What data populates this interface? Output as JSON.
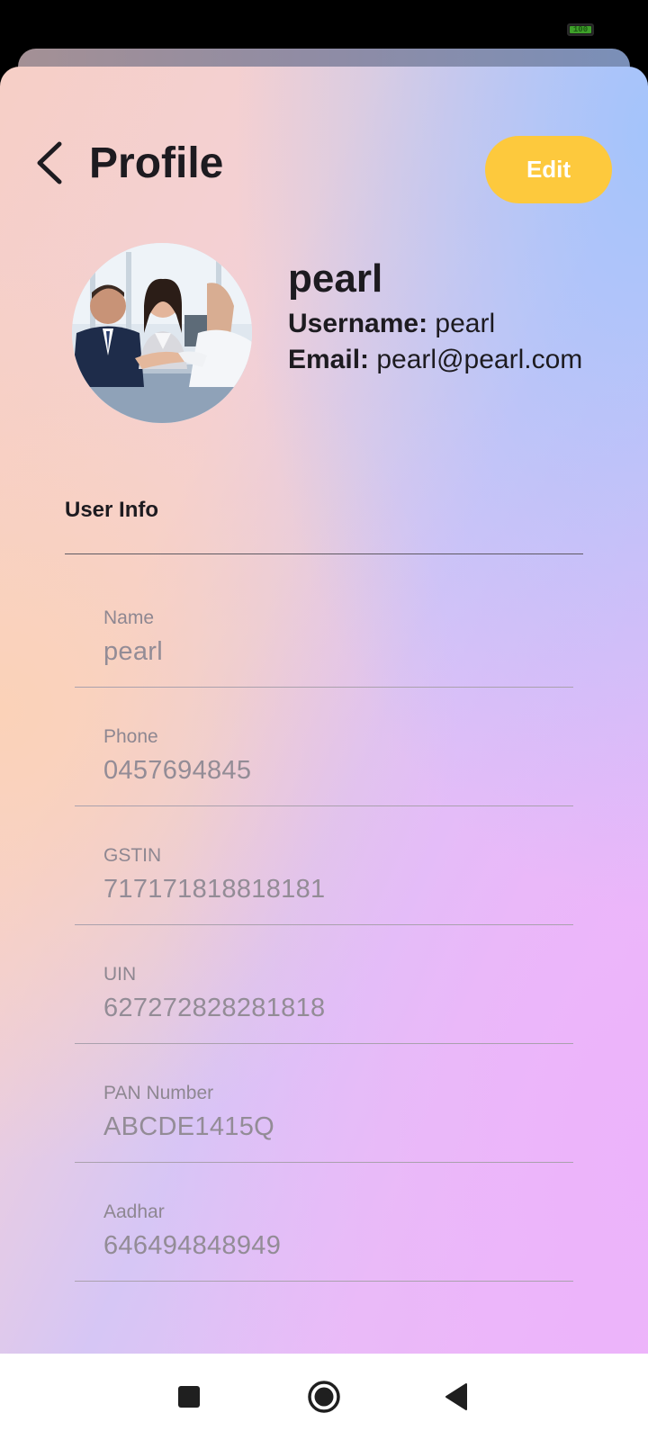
{
  "status_bar": {
    "battery_level": "100",
    "battery_color": "#3ea02a"
  },
  "header": {
    "back_icon": "chevron-left-icon",
    "title": "Profile",
    "edit_label": "Edit",
    "edit_color": "#fdc93d"
  },
  "profile": {
    "avatar_description": "photo",
    "display_name": "pearl",
    "username_label": "Username:",
    "username": "pearl",
    "email_label": "Email:",
    "email": "pearl@pearl.com"
  },
  "user_info": {
    "section_title": "User Info",
    "fields": [
      {
        "label": "Name",
        "value": "pearl"
      },
      {
        "label": "Phone",
        "value": "0457694845"
      },
      {
        "label": "GSTIN",
        "value": "717171818818181"
      },
      {
        "label": "UIN",
        "value": "627272828281818"
      },
      {
        "label": "PAN Number",
        "value": "ABCDE1415Q"
      },
      {
        "label": "Aadhar",
        "value": "646494848949"
      }
    ]
  },
  "nav_bar": {
    "recents_icon": "square-icon",
    "home_icon": "circle-icon",
    "back_icon": "triangle-back-icon"
  }
}
